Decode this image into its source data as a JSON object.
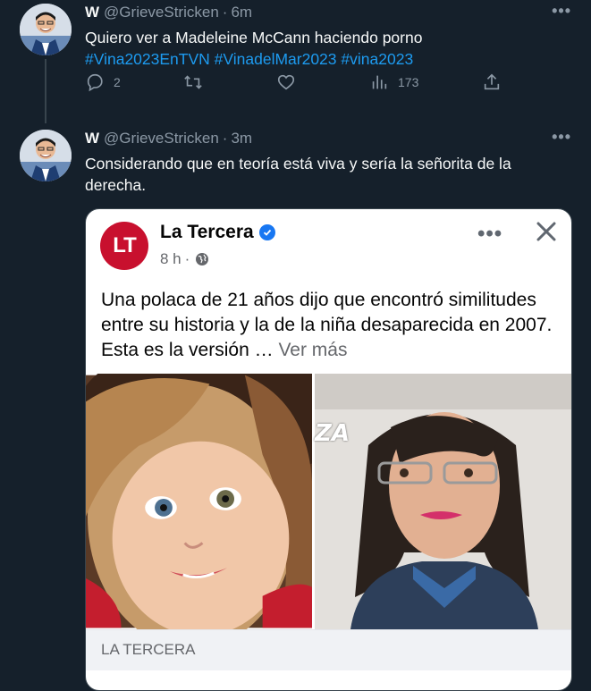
{
  "tweets": [
    {
      "name": "W",
      "handle": "@GrieveStricken",
      "separator": "·",
      "time": "6m",
      "more_icon": "more-dots-icon",
      "text": "Quiero ver a Madeleine McCann haciendo porno",
      "hashtags": [
        "#Vina2023EnTVN",
        "#VinadelMar2023",
        "#vina2023"
      ],
      "actions": {
        "reply_count": "2",
        "retweet_count": "",
        "like_count": "",
        "views_count": "173"
      }
    },
    {
      "name": "W",
      "handle": "@GrieveStricken",
      "separator": "·",
      "time": "3m",
      "text": "Considerando que en teoría está viva y sería la señorita de la derecha.",
      "embed": {
        "page_logo": "LT",
        "page_name": "La Tercera",
        "time": "8 h",
        "sep": "·",
        "post_text": "Una polaca de 21 años dijo que encontró similitudes entre su historia y la de la niña desaparecida en 2007. Esta es la versión …",
        "see_more": "Ver más",
        "photo_overlay_text": "ZA",
        "source_label": "LA TERCERA",
        "more_icon": "horizontal-dots-icon",
        "close_icon": "close-x-icon"
      }
    }
  ],
  "colors": {
    "background": "#15202b",
    "text": "#f7f9f9",
    "muted": "#8b98a5",
    "link": "#1d9bf0",
    "logo_red": "#c8102e",
    "verified_blue": "#1877f2"
  }
}
